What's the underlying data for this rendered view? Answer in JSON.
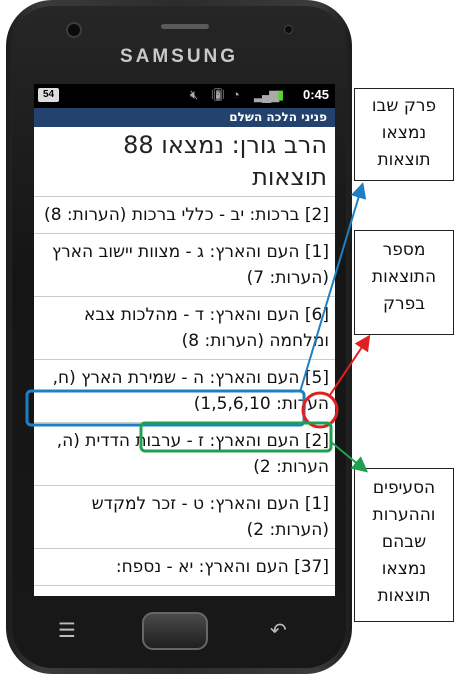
{
  "device": {
    "brand": "SAMSUNG"
  },
  "status_bar": {
    "notification_badge": "54",
    "time": "0:45"
  },
  "app_bar": {
    "title": "פניני הלכה השלם"
  },
  "results": {
    "header": "הרב גורן: נמצאו 88 תוצאות",
    "items": [
      {
        "text": "[2] ברכות: יב - כללי ברכות (הערות: 8)"
      },
      {
        "text": "[1] העם והארץ: ג - מצוות יישוב הארץ (הערות: 7)"
      },
      {
        "text": "[6] העם והארץ: ד - מהלכות צבא ומלחמה (הערות: 8)"
      },
      {
        "text": "[5] העם והארץ: ה - שמירת הארץ (ח, הערות: 1,5,6,10)"
      },
      {
        "text": "[2] העם והארץ: ז - ערבות הדדית (ה, הערות: 2)"
      },
      {
        "text": "[1] העם והארץ: ט - זכר למקדש (הערות: 2)"
      },
      {
        "text": "[37] העם והארץ: יא - נספח:"
      }
    ]
  },
  "callouts": {
    "chapter": "פרק שבו נמצאו תוצאות",
    "count": "מספר התוצאות בפרק",
    "sections": "הסעיפים וההערות שבהם נמצאו תוצאות"
  },
  "annotation_colors": {
    "blue": "#1f7fc4",
    "red": "#e02020",
    "green": "#1fa050"
  }
}
